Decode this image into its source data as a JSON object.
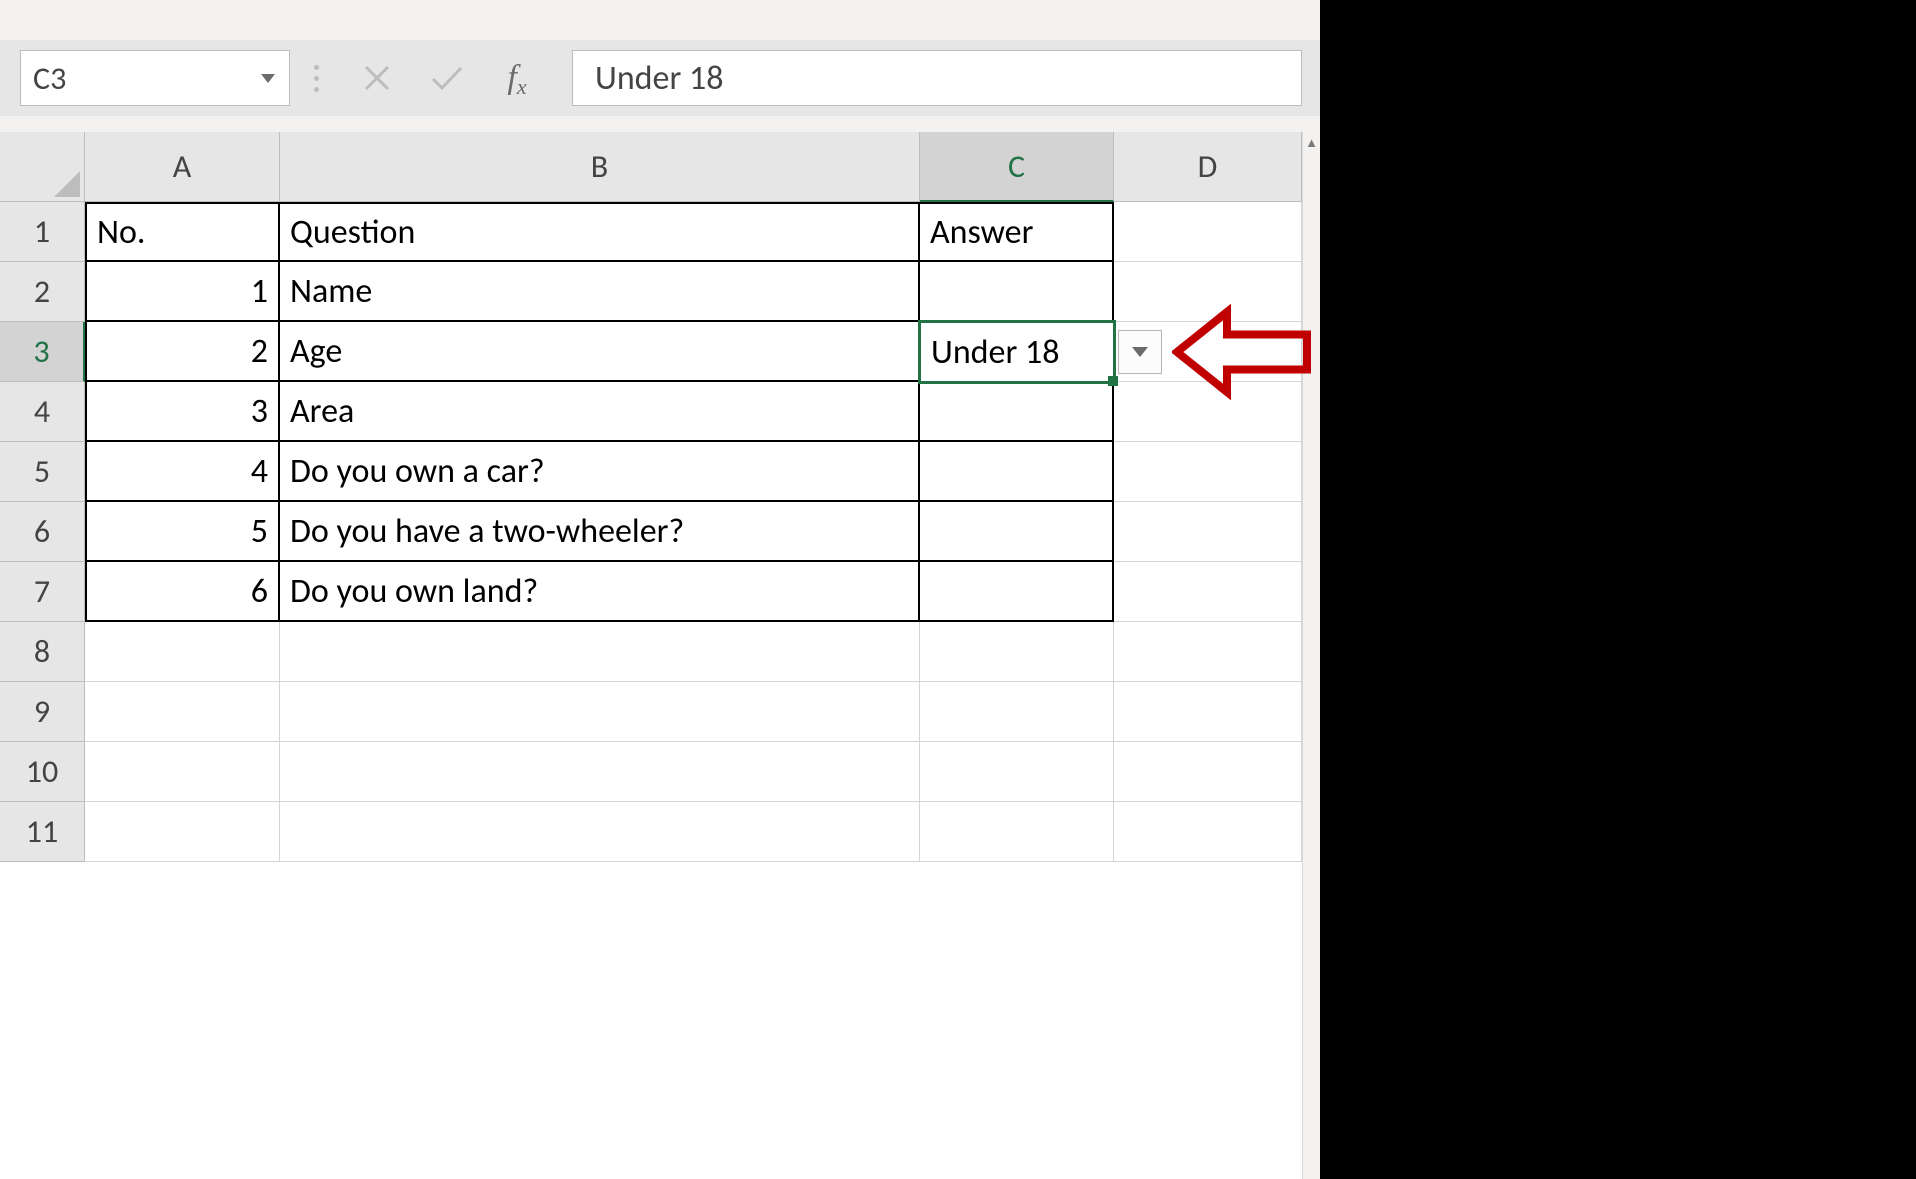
{
  "formula_bar": {
    "name_box": "C3",
    "value": "Under 18"
  },
  "columns": {
    "A": "A",
    "B": "B",
    "C": "C",
    "D": "D"
  },
  "row_labels": [
    "1",
    "2",
    "3",
    "4",
    "5",
    "6",
    "7",
    "8",
    "9",
    "10",
    "11"
  ],
  "headers": {
    "no": "No.",
    "question": "Question",
    "answer": "Answer"
  },
  "rows": [
    {
      "no": "1",
      "question": "Name",
      "answer": ""
    },
    {
      "no": "2",
      "question": "Age",
      "answer": "Under 18"
    },
    {
      "no": "3",
      "question": "Area",
      "answer": ""
    },
    {
      "no": "4",
      "question": "Do you own a car?",
      "answer": ""
    },
    {
      "no": "5",
      "question": "Do you have a two-wheeler?",
      "answer": ""
    },
    {
      "no": "6",
      "question": "Do you own land?",
      "answer": ""
    }
  ],
  "selected_cell_ref": "C3",
  "selected_column": "C",
  "selected_row": "3"
}
